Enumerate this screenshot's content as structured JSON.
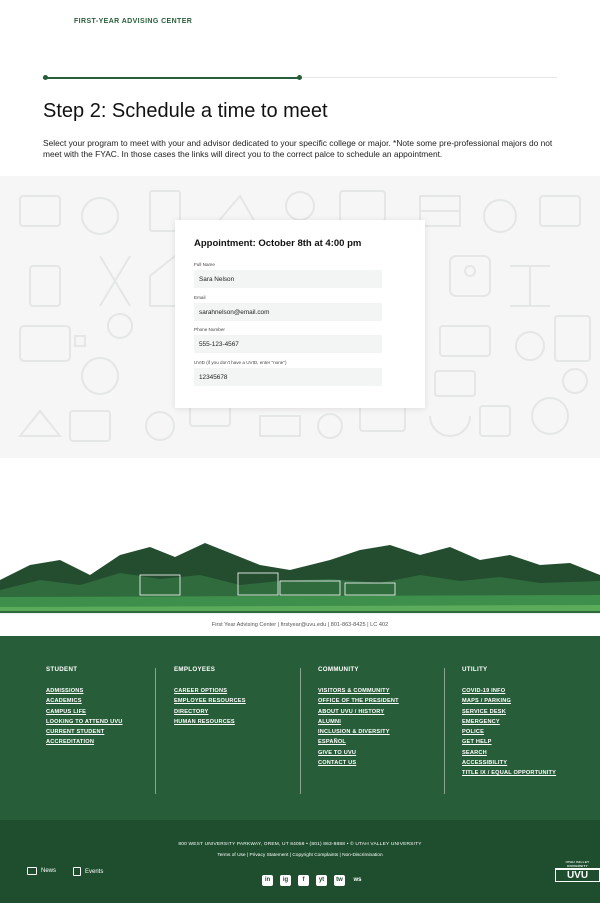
{
  "header": {
    "brand": "FIRST-YEAR ADVISING CENTER"
  },
  "progress": {
    "fraction": 0.5
  },
  "step": {
    "title": "Step 2: Schedule a time to meet",
    "intro": "Select your program to meet with your and advisor dedicated to your specific college or major. *Note some pre-professional majors do not meet with the FYAC. In those cases the links will direct you to the correct palce to schedule an appointment."
  },
  "form": {
    "title": "Appointment: October 8th at 4:00 pm",
    "fields": [
      {
        "label": "Full Name",
        "value": "Sara Nelson"
      },
      {
        "label": "Email",
        "value": "sarahnelson@email.com"
      },
      {
        "label": "Phone Number",
        "value": "555-123-4567"
      },
      {
        "label": "UVID (if you don't have a UVID, enter \"none\")",
        "value": "12345678"
      }
    ]
  },
  "contact": {
    "text": "First Year Advising Center  |  firstyear@uvu.edu  |  801-863-8425  |  LC 402"
  },
  "footer": {
    "columns": [
      {
        "title": "STUDENT",
        "links": [
          "ADMISSIONS",
          "ACADEMICS",
          "CAMPUS LIFE",
          "LOOKING TO ATTEND UVU",
          "CURRENT STUDENT",
          "ACCREDITATION"
        ]
      },
      {
        "title": "EMPLOYEES",
        "links": [
          "CAREER OPTIONS",
          "EMPLOYEE RESOURCES",
          "DIRECTORY",
          "HUMAN RESOURCES"
        ]
      },
      {
        "title": "COMMUNITY",
        "links": [
          "VISITORS & COMMUNITY",
          "OFFICE OF THE PRESIDENT",
          "ABOUT UVU / HISTORY",
          "ALUMNI",
          "INCLUSION & DIVERSITY",
          "ESPAÑOL",
          "GIVE TO UVU",
          "CONTACT US"
        ]
      },
      {
        "title": "UTILITY",
        "links": [
          "COVID-19 INFO",
          "MAPS / PARKING",
          "SERVICE DESK",
          "EMERGENCY",
          "POLICE",
          "GET HELP",
          "SEARCH",
          "ACCESSIBILITY",
          "TITLE IX / EQUAL OPPORTUNITY"
        ]
      }
    ],
    "address": "800 WEST UNIVERSITY PARKWAY, OREM, UT 84058 • (801) 863-8888 • © UTAH VALLEY UNIVERSITY",
    "legal": "Terms of Use  |  Privacy Statement  |  Copyright Complaints  |  Non-Discrimination",
    "news_label": "News",
    "events_label": "Events",
    "logo_small": "UTAH VALLEY UNIVERSITY",
    "logo_big": "UVU",
    "socials": [
      "in",
      "ig",
      "f",
      "yt",
      "tw",
      "ws"
    ]
  },
  "colors": {
    "primary": "#275d38",
    "footer_bottom": "#1f4e2e",
    "field_bg": "#f3f4f4"
  }
}
